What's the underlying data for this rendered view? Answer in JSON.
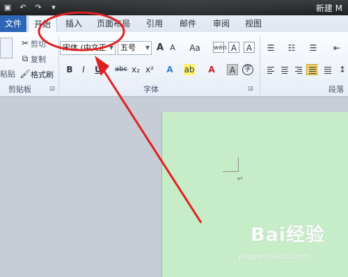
{
  "window": {
    "title": "新建 M"
  },
  "tabs": {
    "file": "文件",
    "items": [
      "开始",
      "插入",
      "页面布局",
      "引用",
      "邮件",
      "审阅",
      "视图"
    ]
  },
  "clipboard": {
    "paste": "粘贴",
    "cut": "剪切",
    "copy": "复制",
    "format_painter": "格式刷",
    "label": "剪贴板"
  },
  "font": {
    "name": "宋体 (中文正",
    "size": "五号",
    "grow": "A",
    "shrink": "A",
    "case": "Aa",
    "bold": "B",
    "italic": "I",
    "underline": "U",
    "strike": "abc",
    "sub": "x₂",
    "sup": "x²",
    "label": "字体"
  },
  "paragraph": {
    "label": "段落"
  },
  "document": {
    "paragraph_mark": "↵"
  },
  "watermark": {
    "brand": "Bai经验",
    "site": "jingyan.baidu.com"
  },
  "colors": {
    "annotation": "#e02020",
    "page": "#c7ecc8",
    "file_tab": "#2c67b7"
  }
}
